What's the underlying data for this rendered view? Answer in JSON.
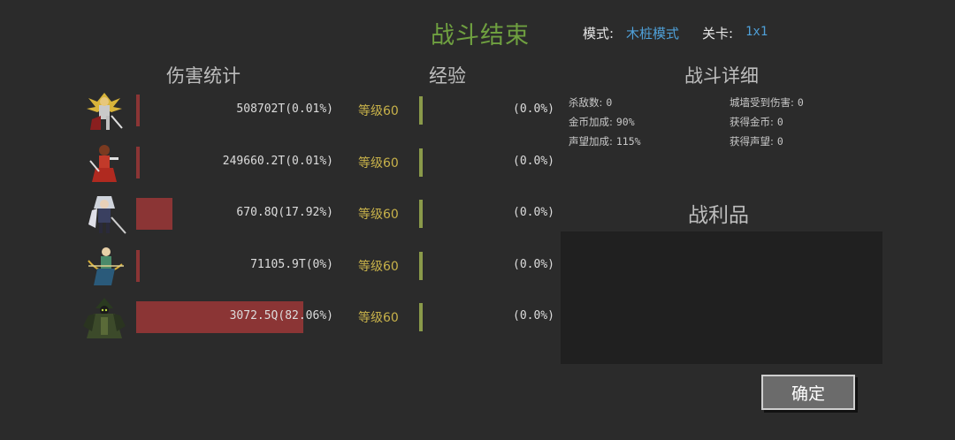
{
  "header": {
    "title": "战斗结束",
    "mode_label": "模式:",
    "mode_value": "木桩模式",
    "stage_label": "关卡:",
    "stage_value": "1x1"
  },
  "sections": {
    "damage": "伤害统计",
    "exp": "经验",
    "detail": "战斗详细",
    "loot": "战利品"
  },
  "heroes": [
    {
      "portrait_icon": "golden-winged-warrior-portrait-icon",
      "damage": "508702T(0.01%)",
      "damage_share": 0.0001,
      "level": "等级60",
      "exp": "(0.0%)"
    },
    {
      "portrait_icon": "red-swordswoman-portrait-icon",
      "damage": "249660.2T(0.01%)",
      "damage_share": 0.0001,
      "level": "等级60",
      "exp": "(0.0%)"
    },
    {
      "portrait_icon": "silver-haired-swordsman-portrait-icon",
      "damage": "670.8Q(17.92%)",
      "damage_share": 0.1792,
      "level": "等级60",
      "exp": "(0.0%)"
    },
    {
      "portrait_icon": "archer-portrait-icon",
      "damage": "71105.9T(0%)",
      "damage_share": 0.0,
      "level": "等级60",
      "exp": "(0.0%)"
    },
    {
      "portrait_icon": "dark-green-mage-portrait-icon",
      "damage": "3072.5Q(82.06%)",
      "damage_share": 0.8206,
      "level": "等级60",
      "exp": "(0.0%)"
    }
  ],
  "details": {
    "kills_label": "杀敌数:",
    "kills": "0",
    "wall_damage_label": "城墙受到伤害:",
    "wall_damage": "0",
    "gold_bonus_label": "金币加成:",
    "gold_bonus": "90%",
    "gold_gained_label": "获得金币:",
    "gold_gained": "0",
    "fame_bonus_label": "声望加成:",
    "fame_bonus": "115%",
    "fame_gained_label": "获得声望:",
    "fame_gained": "0"
  },
  "confirm_label": "确定",
  "colors": {
    "background": "#2b2b2b",
    "title": "#6fa040",
    "link_blue": "#4fa0d8",
    "damage_bar": "#8b3535",
    "level_text": "#c8b24a",
    "exp_bar": "#8a9a4a"
  }
}
